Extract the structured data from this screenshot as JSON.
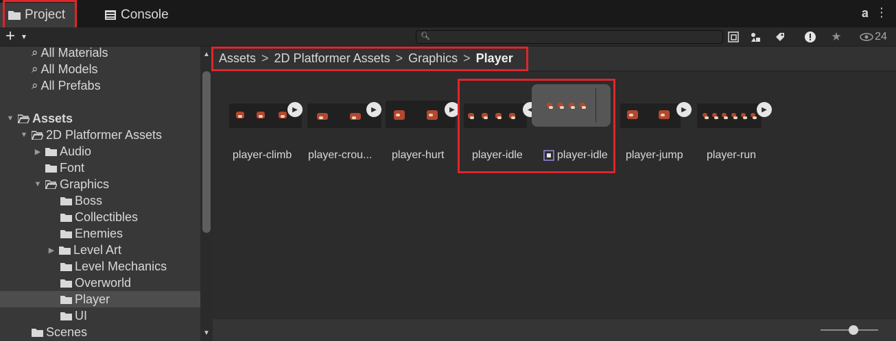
{
  "tabs": [
    {
      "label": "Project",
      "active": true
    },
    {
      "label": "Console",
      "active": false
    }
  ],
  "toolbar": {
    "plus_label": "+",
    "search_placeholder": "",
    "visibility_count": "24"
  },
  "sidebar": {
    "items": [
      {
        "label": "All Materials",
        "kind": "search"
      },
      {
        "label": "All Models",
        "kind": "search"
      },
      {
        "label": "All Prefabs",
        "kind": "search"
      },
      {
        "label": "Assets",
        "kind": "folder-open"
      },
      {
        "label": "2D Platformer Assets",
        "kind": "folder-open"
      },
      {
        "label": "Audio",
        "kind": "folder"
      },
      {
        "label": "Font",
        "kind": "folder"
      },
      {
        "label": "Graphics",
        "kind": "folder-open"
      },
      {
        "label": "Boss",
        "kind": "folder"
      },
      {
        "label": "Collectibles",
        "kind": "folder"
      },
      {
        "label": "Enemies",
        "kind": "folder"
      },
      {
        "label": "Level Art",
        "kind": "folder"
      },
      {
        "label": "Level Mechanics",
        "kind": "folder"
      },
      {
        "label": "Overworld",
        "kind": "folder"
      },
      {
        "label": "Player",
        "kind": "folder",
        "selected": true
      },
      {
        "label": "UI",
        "kind": "folder"
      },
      {
        "label": "Scenes",
        "kind": "folder"
      }
    ]
  },
  "breadcrumb": [
    "Assets",
    "2D Platformer Assets",
    "Graphics",
    "Player"
  ],
  "breadcrumb_sep": ">",
  "assets": [
    {
      "label": "player-climb"
    },
    {
      "label": "player-crou..."
    },
    {
      "label": "player-hurt"
    },
    {
      "label": "player-idle"
    },
    {
      "label": "player-idle",
      "sub_asset": true
    },
    {
      "label": "player-jump"
    },
    {
      "label": "player-run"
    }
  ],
  "colors": {
    "highlight": "#e0252b",
    "fox": "#b4472e"
  }
}
